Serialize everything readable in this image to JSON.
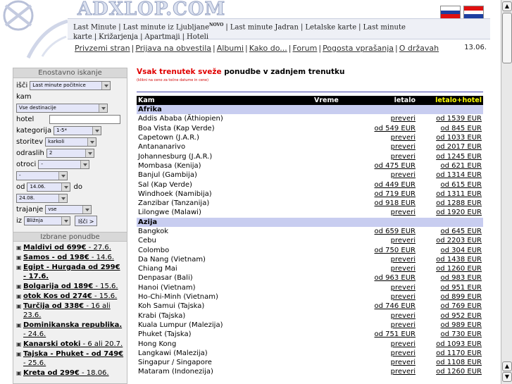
{
  "header": {
    "logo_text": "ADXLOP.COM",
    "nav_row1": [
      "Last Minute",
      "Last minute iz Ljubljane",
      "Last minute Jadran",
      "Letalske karte",
      "Last minute karte",
      "Križarjenja",
      "Apartmaji",
      "Hoteli"
    ],
    "nav_badge": "NOVO",
    "nav_row2": [
      "Privzemi stran",
      "Prijava na obvestila",
      "Albumi",
      "Kako do...",
      "Forum",
      "Pogosta vprašanja",
      "O državah"
    ],
    "date": "13.06."
  },
  "search": {
    "heading": "Enostavno iskanje",
    "isci_label": "išči",
    "isci_value": "Last minute počitnice",
    "kam_label": "kam",
    "kam_value": "Vse destinacije",
    "hotel_label": "hotel",
    "kategorija_label": "kategorija",
    "kategorija_value": "1-5*",
    "storitev_label": "storitev",
    "storitev_value": "karkoli",
    "odraslih_label": "odraslih",
    "odraslih_value": "2",
    "otroci_label": "otroci",
    "otroci_value": "-",
    "extra_value": "-",
    "od_label": "od",
    "od_value": "14.06.",
    "do_label": "do",
    "do_value": "24.08.",
    "trajanje_label": "trajanje",
    "trajanje_value": "vse",
    "iz_label": "iz",
    "iz_value": "Bližnja",
    "isci_button": "Išči >"
  },
  "featured": {
    "heading": "Izbrane ponudbe",
    "items": [
      {
        "bold": "Maldivi od 699€",
        "rest": " - 27.6."
      },
      {
        "bold": "Samos - od 198€",
        "rest": " - 14.6."
      },
      {
        "bold": "Egipt - Hurgada od 299€ - 17.6.",
        "rest": ""
      },
      {
        "bold": "Bolgarija od 189€",
        "rest": " - 15.6."
      },
      {
        "bold": "otok Kos od 274€",
        "rest": " - 15.6."
      },
      {
        "bold": "Turčija od 338€",
        "rest": " - 16 ali 23.6."
      },
      {
        "bold": "Dominikanska republika.",
        "rest": " - 24.6."
      },
      {
        "bold": "Kanarski otoki",
        "rest": " - 6 ali 20.7."
      },
      {
        "bold": "Tajska - Phuket - od 749€",
        "rest": " - 25.6."
      },
      {
        "bold": "Kreta od 299€",
        "rest": " - 18.06."
      }
    ]
  },
  "main": {
    "title_red": "Vsak trenutek sveže",
    "title_rest": " ponudbe v zadnjem trenutku",
    "hint": "(klikni na ceno za točne datume in cene)",
    "columns": [
      "Kam",
      "Vreme",
      "letalo",
      "letalo+hotel"
    ],
    "sections": [
      {
        "name": "Afrika",
        "rows": [
          [
            "Addis Ababa (Äthiopien)",
            "preveri",
            "od 1539 EUR"
          ],
          [
            "Boa Vista (Kap Verde)",
            "od 549 EUR",
            "od 845 EUR"
          ],
          [
            "Capetown (J.A.R.)",
            "preveri",
            "od 1033 EUR"
          ],
          [
            "Antananarivo",
            "preveri",
            "od 2017 EUR"
          ],
          [
            "Johannesburg (J.A.R.)",
            "preveri",
            "od 1245 EUR"
          ],
          [
            "Mombasa (Kenija)",
            "od 475 EUR",
            "od 621 EUR"
          ],
          [
            "Banjul (Gambija)",
            "preveri",
            "od 1314 EUR"
          ],
          [
            "Sal (Kap Verde)",
            "od 449 EUR",
            "od 615 EUR"
          ],
          [
            "Windhoek (Namibija)",
            "od 719 EUR",
            "od 1311 EUR"
          ],
          [
            "Zanzibar (Tanzanija)",
            "od 918 EUR",
            "od 1288 EUR"
          ],
          [
            "Lilongwe (Malawi)",
            "preveri",
            "od 1920 EUR"
          ]
        ]
      },
      {
        "name": "Azija",
        "rows": [
          [
            "Bangkok",
            "od 659 EUR",
            "od 645 EUR"
          ],
          [
            "Cebu",
            "preveri",
            "od 2203 EUR"
          ],
          [
            "Colombo",
            "od 750 EUR",
            "od 304 EUR"
          ],
          [
            "Da Nang (Vietnam)",
            "preveri",
            "od 1438 EUR"
          ],
          [
            "Chiang Mai",
            "preveri",
            "od 1260 EUR"
          ],
          [
            "Denpasar (Bali)",
            "od 963 EUR",
            "od 983 EUR"
          ],
          [
            "Hanoi (Vietnam)",
            "preveri",
            "od 951 EUR"
          ],
          [
            "Ho-Chi-Minh (Vietnam)",
            "preveri",
            "od 899 EUR"
          ],
          [
            "Koh Samui (Tajska)",
            "od 746 EUR",
            "od 769 EUR"
          ],
          [
            "Krabi (Tajska)",
            "preveri",
            "od 952 EUR"
          ],
          [
            "Kuala Lumpur (Malezija)",
            "preveri",
            "od 989 EUR"
          ],
          [
            "Phuket (Tajska)",
            "od 751 EUR",
            "od 730 EUR"
          ],
          [
            "Hong Kong",
            "preveri",
            "od 1093 EUR"
          ],
          [
            "Langkawi (Malezija)",
            "preveri",
            "od 1170 EUR"
          ],
          [
            "Singapur / Singapore",
            "preveri",
            "od 1108 EUR"
          ],
          [
            "Mataram (Indonezija)",
            "preveri",
            "od 1260 EUR"
          ]
        ]
      }
    ]
  },
  "colors": {
    "accent_red": "#e00000",
    "section_bg": "#c8cdf0",
    "header_yellow": "#ffff00"
  }
}
